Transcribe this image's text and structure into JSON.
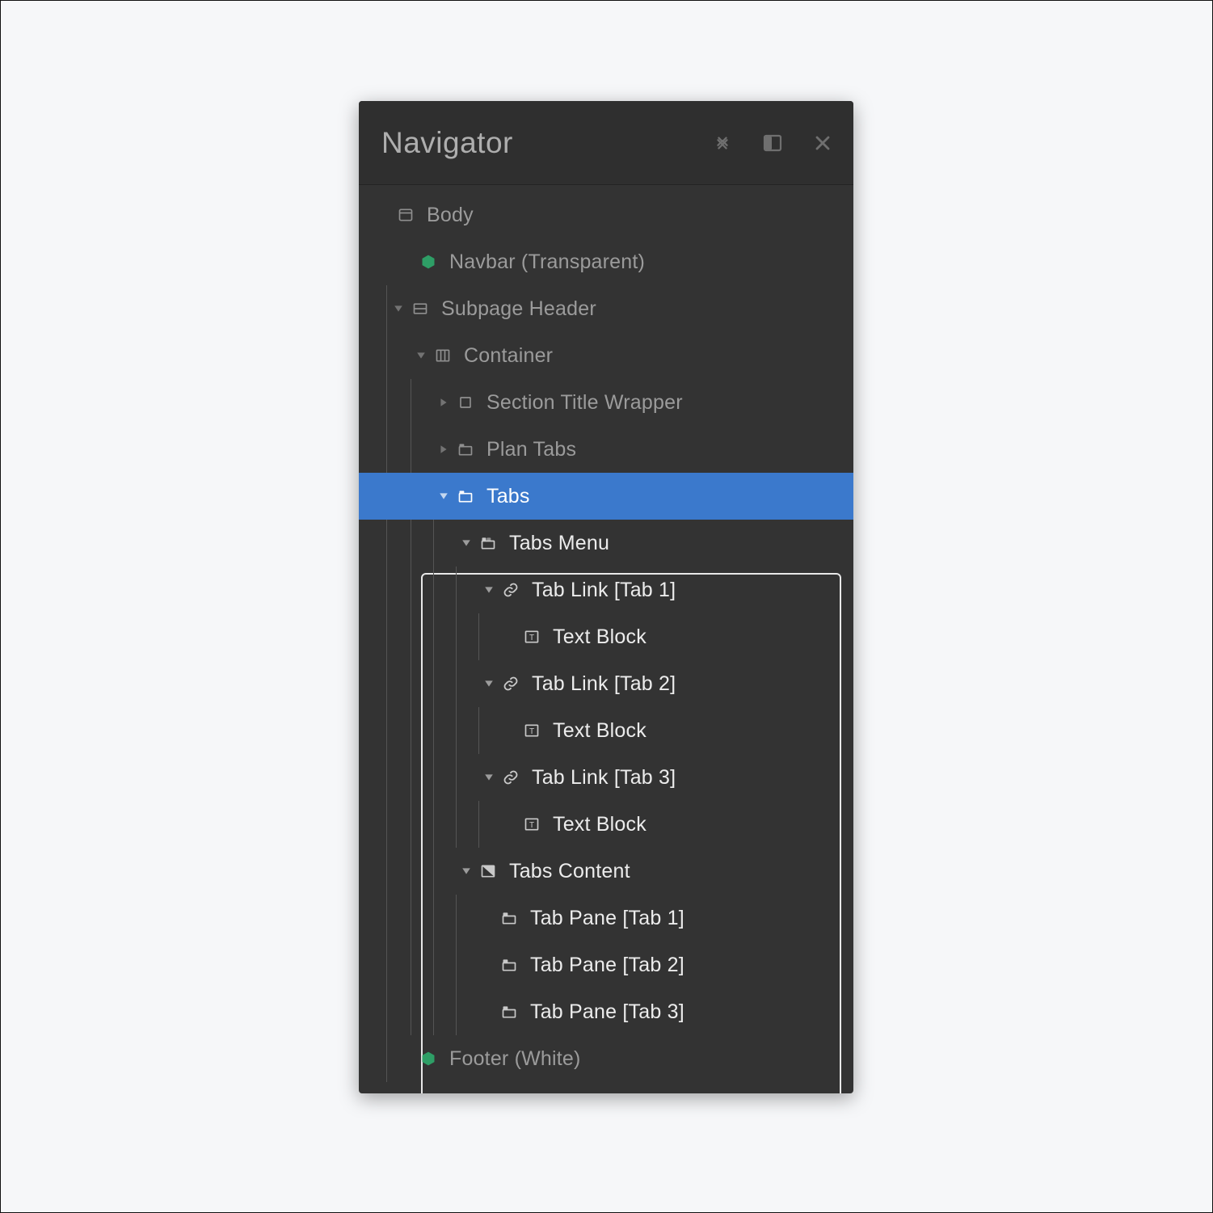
{
  "header": {
    "title": "Navigator"
  },
  "tree": {
    "body": "Body",
    "navbar": "Navbar (Transparent)",
    "subpage_header": "Subpage Header",
    "container": "Container",
    "section_title_wrapper": "Section Title Wrapper",
    "plan_tabs": "Plan Tabs",
    "tabs": "Tabs",
    "tabs_menu": "Tabs Menu",
    "tab_link_1": "Tab Link [Tab 1]",
    "text_block_1": "Text Block",
    "tab_link_2": "Tab Link [Tab 2]",
    "text_block_2": "Text Block",
    "tab_link_3": "Tab Link [Tab 3]",
    "text_block_3": "Text Block",
    "tabs_content": "Tabs Content",
    "tab_pane_1": "Tab Pane [Tab 1]",
    "tab_pane_2": "Tab Pane [Tab 2]",
    "tab_pane_3": "Tab Pane [Tab 3]",
    "footer": "Footer (White)"
  }
}
